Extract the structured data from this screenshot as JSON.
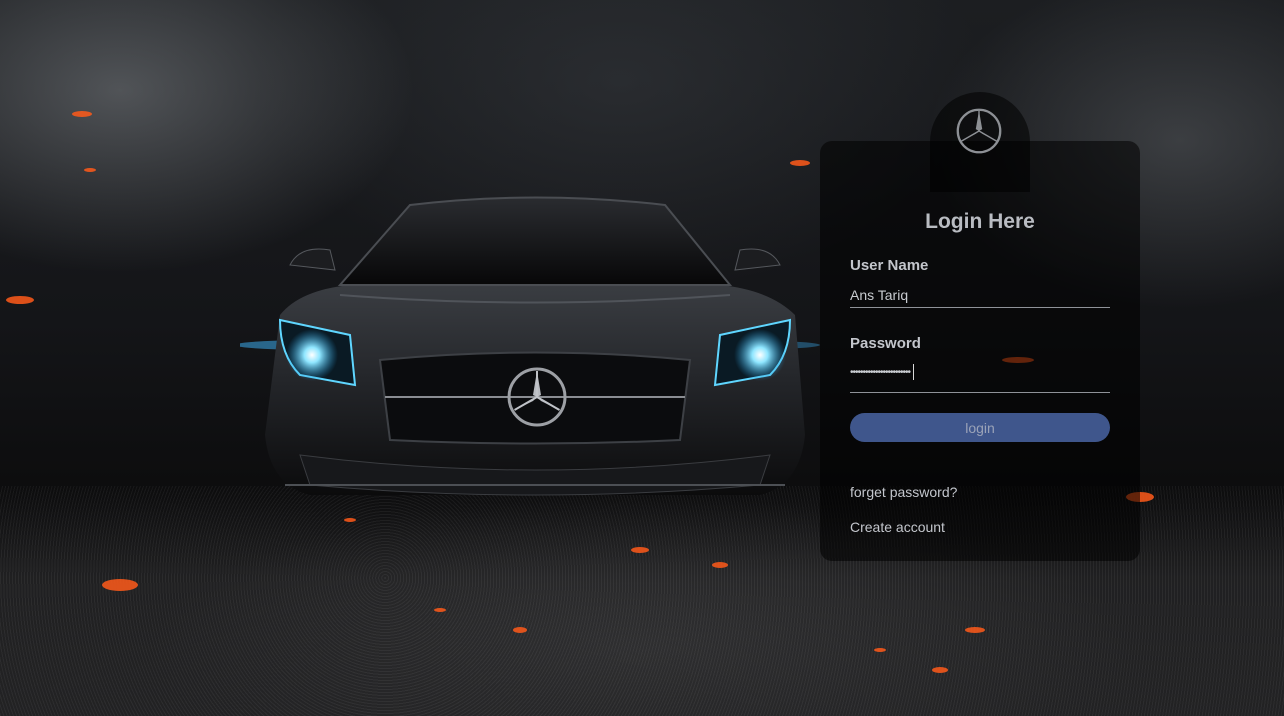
{
  "login": {
    "title": "Login Here",
    "username_label": "User Name",
    "username_value": "Ans Tariq",
    "password_label": "Password",
    "password_masked": "••••••••••••••••••••••••",
    "login_button": "login",
    "forgot_link": "forget password?",
    "create_link": "Create account"
  },
  "colors": {
    "button": "#3f568c",
    "headlight": "#5fd6ff",
    "ember": "#ff5a1a"
  },
  "icons": {
    "brand": "three-pointed-star-logo"
  }
}
